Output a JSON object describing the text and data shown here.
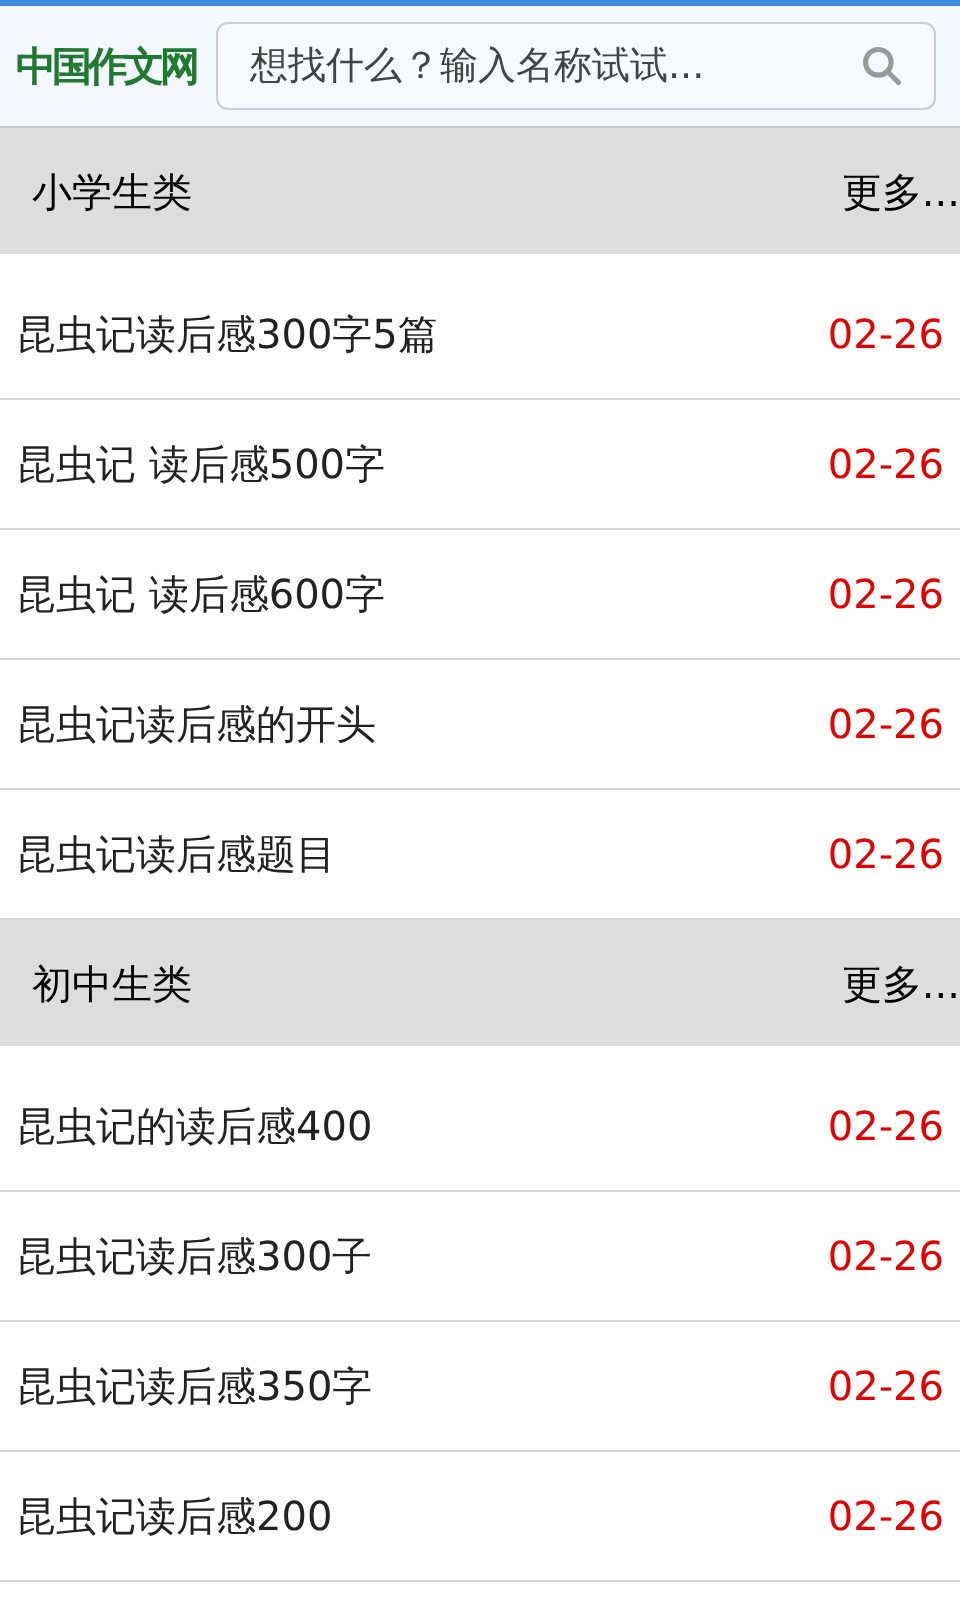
{
  "header": {
    "logo": "中国作文网",
    "search": {
      "placeholder": "想找什么？输入名称试试..."
    }
  },
  "sections": [
    {
      "title": "小学生类",
      "more": "更多...",
      "items": [
        {
          "title": "昆虫记读后感300字5篇",
          "date": "02-26"
        },
        {
          "title": "昆虫记 读后感500字",
          "date": "02-26"
        },
        {
          "title": "昆虫记 读后感600字",
          "date": "02-26"
        },
        {
          "title": "昆虫记读后感的开头",
          "date": "02-26"
        },
        {
          "title": "昆虫记读后感题目",
          "date": "02-26"
        }
      ]
    },
    {
      "title": "初中生类",
      "more": "更多...",
      "items": [
        {
          "title": "昆虫记的读后感400",
          "date": "02-26"
        },
        {
          "title": "昆虫记读后感300子",
          "date": "02-26"
        },
        {
          "title": "昆虫记读后感350字",
          "date": "02-26"
        },
        {
          "title": "昆虫记读后感200",
          "date": "02-26"
        }
      ]
    }
  ]
}
